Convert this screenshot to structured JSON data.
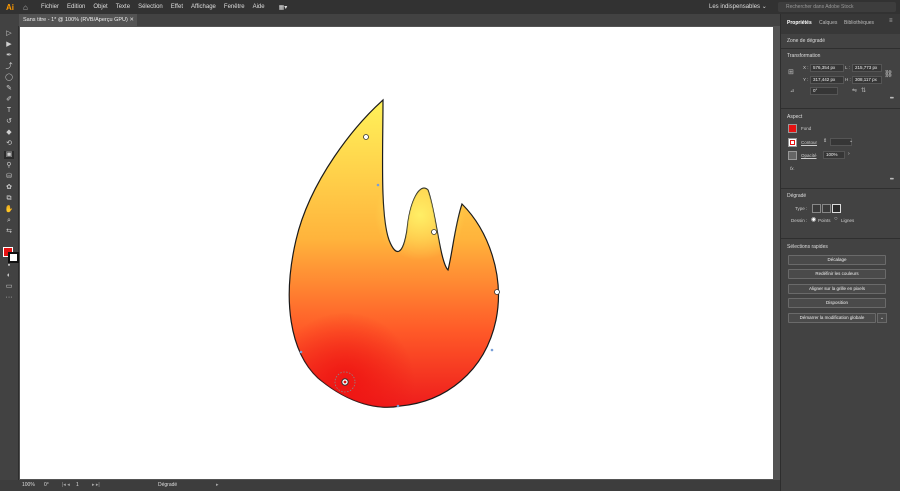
{
  "app": {
    "logo": "Ai",
    "home_icon": "home-icon"
  },
  "menu": [
    "Fichier",
    "Edition",
    "Objet",
    "Texte",
    "Sélection",
    "Effet",
    "Affichage",
    "Fenêtre",
    "Aide"
  ],
  "workspace": {
    "label": "Les indispensables",
    "chevron": "⌄"
  },
  "search": {
    "placeholder": "Rechercher dans Adobe Stock"
  },
  "document": {
    "tab_title": "Sans titre - 1* @ 100% (RVB/Aperçu GPU)",
    "close": "✕"
  },
  "status": {
    "zoom": "100%",
    "rotation": "0°",
    "page": "1",
    "tool": "Dégradé"
  },
  "panel": {
    "tabs": [
      "Propriétés",
      "Calques",
      "Bibliothèques"
    ],
    "object_label": "Zone de dégradé",
    "transformation": {
      "title": "Transformation",
      "x_label": "X :",
      "x": "576,354 px",
      "y_label": "Y :",
      "y": "317,442 px",
      "l_label": "L :",
      "l": "215,773 px",
      "h_label": "H :",
      "h": "308,117 px",
      "angle": "0°"
    },
    "aspect": {
      "title": "Aspect",
      "fill_label": "Fond",
      "stroke_label": "Contour",
      "opacity_label": "Opacité",
      "opacity": "100%",
      "fx": "fx."
    },
    "gradient": {
      "title": "Dégradé",
      "type_label": "Type :",
      "draw_label": "Dessin :",
      "points_label": "Points",
      "lines_label": "Lignes"
    },
    "selection": {
      "title": "Sélections rapides",
      "buttons": [
        "Décalage",
        "Redéfinir les couleurs",
        "Aligner sur la grille en pixels",
        "Disposition",
        "Démarrer la modification globale"
      ]
    }
  },
  "colors": {
    "fill": "#e51212",
    "accent": "#ff9a00",
    "flame_top": "#fff25a",
    "flame_bottom": "#ee1c1c"
  }
}
